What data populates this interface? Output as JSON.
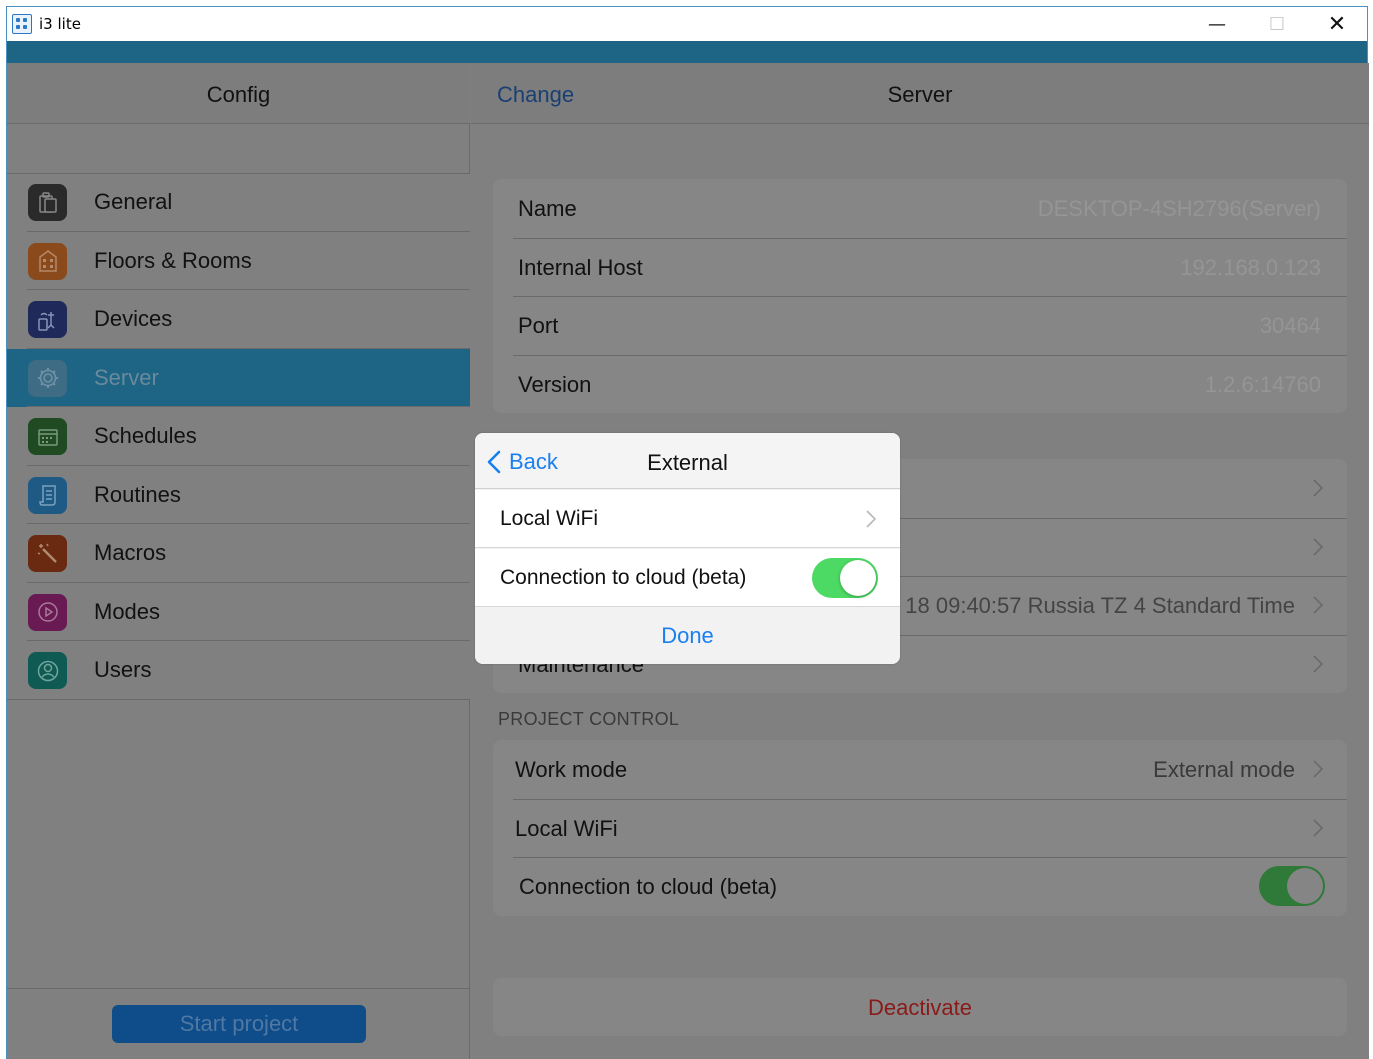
{
  "window": {
    "title": "i3 lite",
    "minimize_glyph": "—",
    "maximize_glyph": "☐",
    "close_glyph": "✕"
  },
  "sidebar": {
    "title": "Config",
    "items": [
      {
        "label": "General",
        "icon": "clipboard-icon",
        "color": "#2a2a2a"
      },
      {
        "label": "Floors & Rooms",
        "icon": "building-icon",
        "color": "#8a4a1c"
      },
      {
        "label": "Devices",
        "icon": "devices-icon",
        "color": "#1f2a5a"
      },
      {
        "label": "Server",
        "icon": "gear-icon",
        "color": "#3e6c84",
        "active": true
      },
      {
        "label": "Schedules",
        "icon": "calendar-icon",
        "color": "#1f4a22"
      },
      {
        "label": "Routines",
        "icon": "scroll-icon",
        "color": "#1e5a84"
      },
      {
        "label": "Macros",
        "icon": "magic-wand-icon",
        "color": "#6a2a12"
      },
      {
        "label": "Modes",
        "icon": "play-icon",
        "color": "#6a1a52"
      },
      {
        "label": "Users",
        "icon": "users-icon",
        "color": "#0f5a52"
      }
    ],
    "start_button": "Start project"
  },
  "header": {
    "change_label": "Change",
    "title": "Server"
  },
  "server_info": [
    {
      "label": "Name",
      "value": "DESKTOP-4SH2796(Server)"
    },
    {
      "label": "Internal Host",
      "value": "192.168.0.123"
    },
    {
      "label": "Port",
      "value": "30464"
    },
    {
      "label": "Version",
      "value": "1.2.6:14760"
    }
  ],
  "second_group": {
    "time_value": "18 09:40:57 Russia TZ 4 Standard Time",
    "partial_label": "Maintenance"
  },
  "project_control": {
    "section_label": "PROJECT CONTROL",
    "work_mode_label": "Work mode",
    "work_mode_value": "External mode",
    "local_wifi_label": "Local WiFi",
    "cloud_label": "Connection to cloud (beta)",
    "cloud_enabled": true
  },
  "deactivate_label": "Deactivate",
  "modal": {
    "back_label": "Back",
    "title": "External",
    "local_wifi_label": "Local WiFi",
    "cloud_label": "Connection to cloud (beta)",
    "cloud_enabled": true,
    "done_label": "Done"
  },
  "colors": {
    "accent": "#1e6484",
    "ios_blue": "#1a7ff0",
    "ios_green": "#4cd964",
    "destructive": "#d0342c"
  }
}
